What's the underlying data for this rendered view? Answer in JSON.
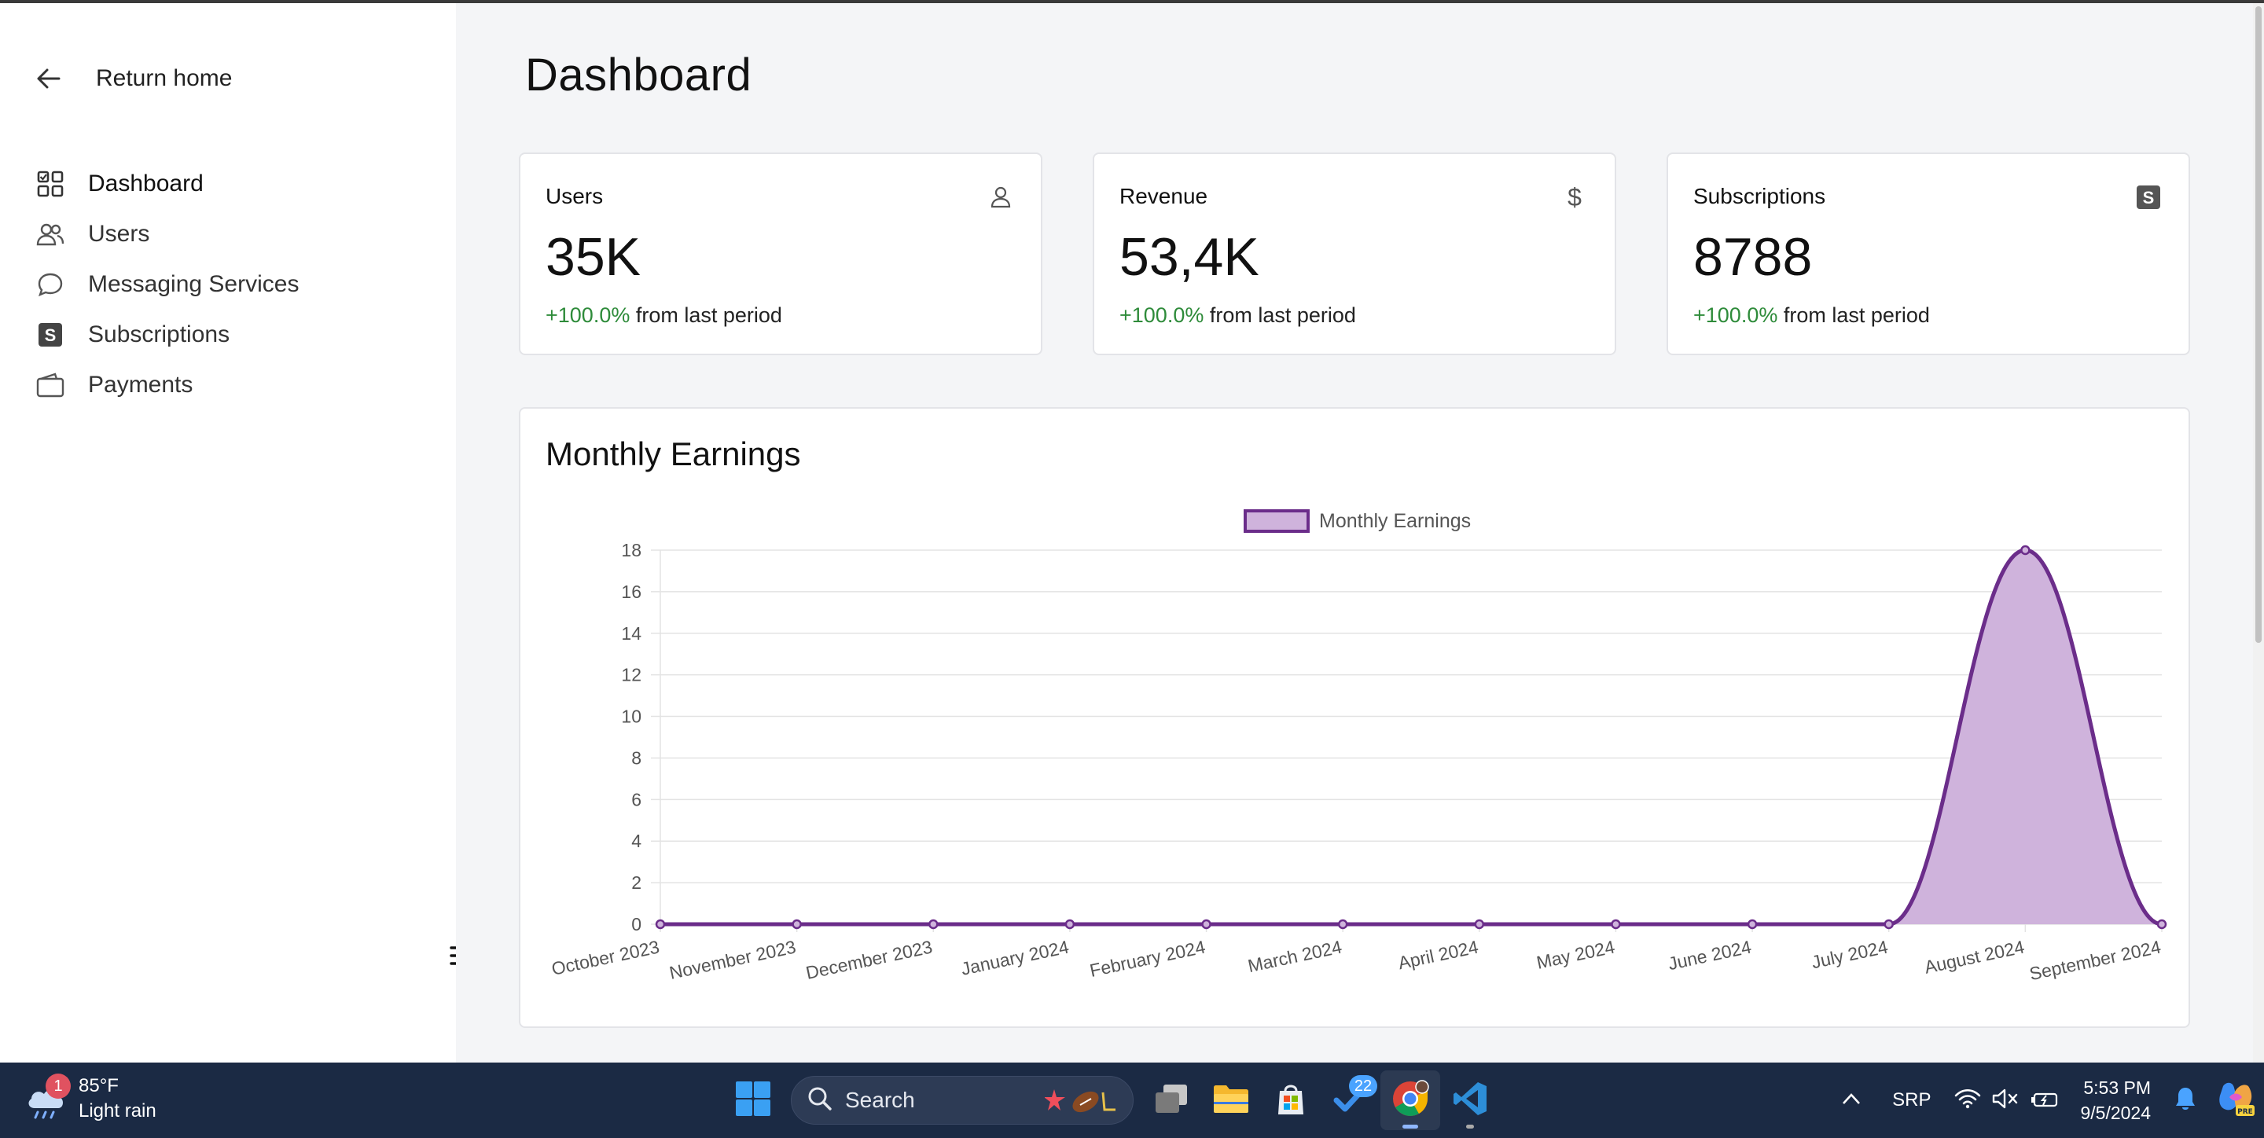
{
  "sidebar": {
    "return_label": "Return home",
    "items": [
      {
        "label": "Dashboard",
        "icon": "dashboard-grid-icon",
        "active": true
      },
      {
        "label": "Users",
        "icon": "users-icon"
      },
      {
        "label": "Messaging Services",
        "icon": "chat-bubble-icon"
      },
      {
        "label": "Subscriptions",
        "icon": "subscriptions-s-icon"
      },
      {
        "label": "Payments",
        "icon": "wallet-icon"
      }
    ]
  },
  "page": {
    "title": "Dashboard"
  },
  "stats": [
    {
      "title": "Users",
      "value": "35K",
      "change": "+100.0%",
      "suffix": " from last period",
      "icon": "user-icon"
    },
    {
      "title": "Revenue",
      "value": "53,4K",
      "change": "+100.0%",
      "suffix": " from last period",
      "icon": "dollar-icon"
    },
    {
      "title": "Subscriptions",
      "value": "8788",
      "change": "+100.0%",
      "suffix": " from last period",
      "icon": "subscriptions-s-icon"
    }
  ],
  "colors": {
    "accent_stroke": "#6b2d8a",
    "accent_fill": "#cfb3dc",
    "positive": "#2e8b3a",
    "taskbar": "#1b2a44"
  },
  "chart_data": {
    "type": "area",
    "title": "Monthly Earnings",
    "x": [
      "October 2023",
      "November 2023",
      "December 2023",
      "January 2024",
      "February 2024",
      "March 2024",
      "April 2024",
      "May 2024",
      "June 2024",
      "July 2024",
      "August 2024",
      "September 2024"
    ],
    "series": [
      {
        "name": "Monthly Earnings",
        "values": [
          0,
          0,
          0,
          0,
          0,
          0,
          0,
          0,
          0,
          0,
          18,
          0
        ]
      }
    ],
    "yticks": [
      0,
      2,
      4,
      6,
      8,
      10,
      12,
      14,
      16,
      18
    ],
    "ylim": [
      0,
      18
    ],
    "legend": "top-center",
    "grid": true
  },
  "taskbar": {
    "weather_temp": "85°F",
    "weather_desc": "Light rain",
    "weather_badge": "1",
    "search_label": "Search",
    "todo_badge": "22",
    "language": "SRP",
    "time": "5:53 PM",
    "date": "9/5/2024"
  }
}
